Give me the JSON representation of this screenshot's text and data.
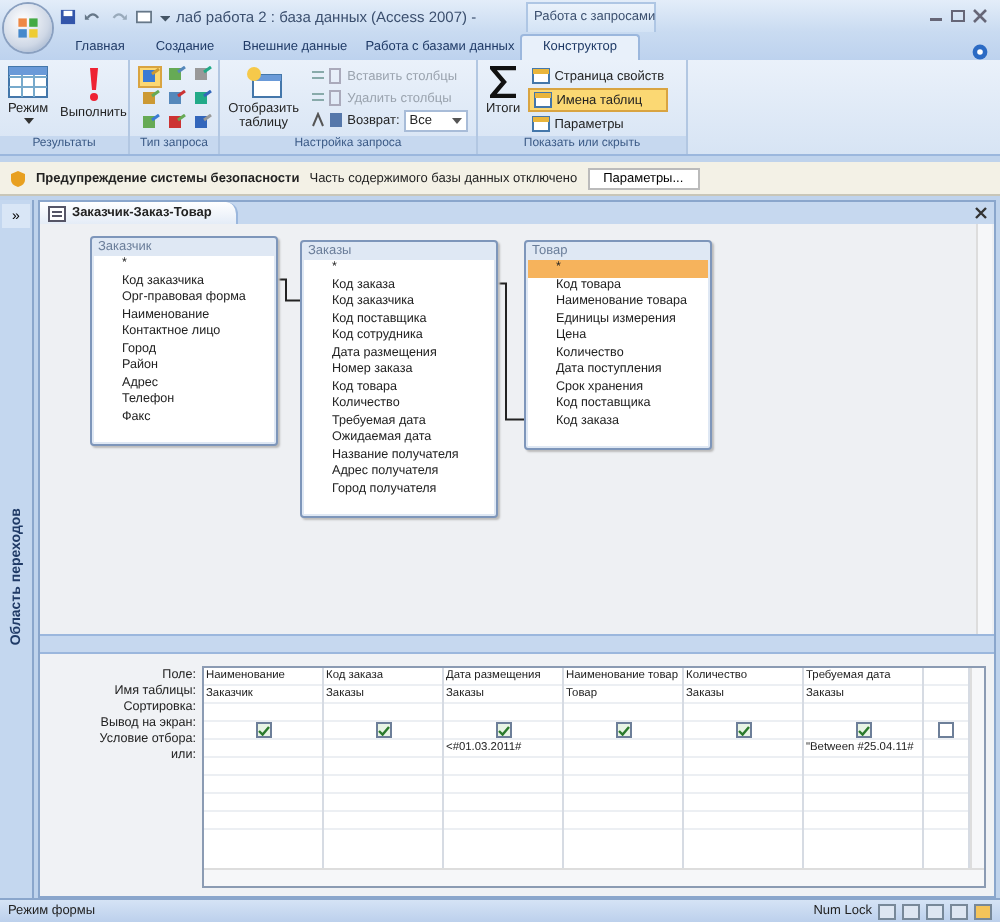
{
  "window": {
    "title": "лаб работа 2 : база данных (Access 2007) -",
    "contextual_group": "Работа с запросами"
  },
  "tabs": [
    {
      "label": "Главная",
      "selected": false
    },
    {
      "label": "Создание",
      "selected": false
    },
    {
      "label": "Внешние данные",
      "selected": false
    },
    {
      "label": "Работа с базами данных",
      "selected": false
    },
    {
      "label": "Конструктор",
      "selected": true
    }
  ],
  "ribbon": {
    "results": {
      "label": "Результаты",
      "buttons": [
        {
          "label": "Режим",
          "kind": "view"
        },
        {
          "label": "Выполнить",
          "kind": "run"
        }
      ]
    },
    "query_type": {
      "label": "Тип запроса",
      "buttons": [
        {
          "on": true
        },
        {
          "on": false
        },
        {
          "on": false
        },
        {
          "on": false
        },
        {
          "on": false
        },
        {
          "on": false
        },
        {
          "on": false
        },
        {
          "on": false
        },
        {
          "on": false
        }
      ]
    },
    "query_setup": {
      "label": "Настройка запроса",
      "show_table": "Отобразить таблицу",
      "items": [
        {
          "label": "Вставить столбцы",
          "disabled": true
        },
        {
          "label": "Удалить столбцы",
          "disabled": true
        }
      ],
      "return_label": "Возврат:",
      "return_value": "Все"
    },
    "show_hide": {
      "label": "Показать или скрыть",
      "totals": "Итоги",
      "items": [
        {
          "label": "Страница свойств",
          "on": false
        },
        {
          "label": "Имена таблиц",
          "on": true
        },
        {
          "label": "Параметры",
          "on": false
        }
      ]
    }
  },
  "security_bar": {
    "title": "Предупреждение системы безопасности",
    "message": "Часть содержимого базы данных отключено",
    "button": "Параметры..."
  },
  "nav_pane": {
    "toggle": "»",
    "label": "Область переходов"
  },
  "document_tab": {
    "title": "Заказчик-Заказ-Товар"
  },
  "tables": [
    {
      "name": "Заказчик",
      "fields": [
        {
          "name": "*",
          "selected": false
        },
        {
          "name": "Код заказчика",
          "selected": false
        },
        {
          "name": "Орг-правовая форма",
          "selected": false
        },
        {
          "name": "Наименование",
          "selected": false
        },
        {
          "name": "Контактное лицо",
          "selected": false
        },
        {
          "name": "Город",
          "selected": false
        },
        {
          "name": "Район",
          "selected": false
        },
        {
          "name": "Адрес",
          "selected": false
        },
        {
          "name": "Телефон",
          "selected": false
        },
        {
          "name": "Факс",
          "selected": false
        }
      ]
    },
    {
      "name": "Заказы",
      "fields": [
        {
          "name": "*",
          "selected": false
        },
        {
          "name": "Код заказа",
          "selected": false
        },
        {
          "name": "Код заказчика",
          "selected": false
        },
        {
          "name": "Код поставщика",
          "selected": false
        },
        {
          "name": "Код сотрудника",
          "selected": false
        },
        {
          "name": "Дата размещения",
          "selected": false
        },
        {
          "name": "Номер заказа",
          "selected": false
        },
        {
          "name": "Код товара",
          "selected": false
        },
        {
          "name": "Количество",
          "selected": false
        },
        {
          "name": "Требуемая дата",
          "selected": false
        },
        {
          "name": "Ожидаемая дата",
          "selected": false
        },
        {
          "name": "Название получателя",
          "selected": false
        },
        {
          "name": "Адрес получателя",
          "selected": false
        },
        {
          "name": "Город получателя",
          "selected": false
        }
      ]
    },
    {
      "name": "Товар",
      "fields": [
        {
          "name": "*",
          "selected": true
        },
        {
          "name": "Код товара",
          "selected": false
        },
        {
          "name": "Наименование товара",
          "selected": false
        },
        {
          "name": "Единицы измерения",
          "selected": false
        },
        {
          "name": "Цена",
          "selected": false
        },
        {
          "name": "Количество",
          "selected": false
        },
        {
          "name": "Дата поступления",
          "selected": false
        },
        {
          "name": "Срок хранения",
          "selected": false
        },
        {
          "name": "Код поставщика",
          "selected": false
        },
        {
          "name": "Код заказа",
          "selected": false
        }
      ]
    }
  ],
  "grid": {
    "row_labels": [
      "Поле:",
      "Имя таблицы:",
      "Сортировка:",
      "Вывод на экран:",
      "Условие отбора:",
      "или:"
    ],
    "columns": [
      {
        "field": "Наименование",
        "table": "Заказчик",
        "show": true
      },
      {
        "field": "Код заказа",
        "table": "Заказы",
        "show": true
      },
      {
        "field": "Дата размещения",
        "table": "Заказы",
        "show": true,
        "criteria": "<#01.03.2011#"
      },
      {
        "field": "Наименование товар",
        "table": "Товар",
        "show": true
      },
      {
        "field": "Количество",
        "table": "Заказы",
        "show": true
      },
      {
        "field": "Требуемая дата",
        "table": "Заказы",
        "show": true,
        "criteria": "\"Between #25.04.11#"
      },
      {
        "show": false
      }
    ]
  },
  "status_bar": {
    "mode": "Режим формы",
    "num_lock": "Num Lock"
  }
}
